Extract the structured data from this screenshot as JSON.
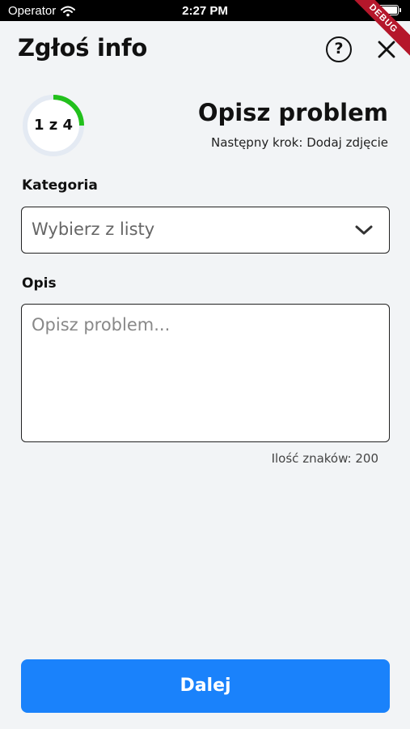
{
  "status_bar": {
    "carrier": "Operator",
    "time": "2:27 PM"
  },
  "debug_banner": "DEBUG",
  "app_bar": {
    "title": "Zgłoś info",
    "help_label": "?",
    "help_icon": "question-circle-icon",
    "close_icon": "close-icon"
  },
  "step": {
    "indicator": "1 z 4",
    "current": 1,
    "total": 4,
    "progress_fraction": 0.25,
    "title": "Opisz problem",
    "next_step": "Następny krok: Dodaj zdjęcie"
  },
  "category": {
    "label": "Kategoria",
    "placeholder": "Wybierz z listy",
    "icon": "chevron-down-icon"
  },
  "description": {
    "label": "Opis",
    "placeholder": "Opisz problem...",
    "char_count": "Ilość znaków: 200"
  },
  "next_button": {
    "label": "Dalej"
  },
  "colors": {
    "accent": "#1a82fb",
    "progress": "#22c01c",
    "progress_track": "#e4eaf3",
    "background": "#f2f4f6",
    "debug": "#b5172b"
  }
}
